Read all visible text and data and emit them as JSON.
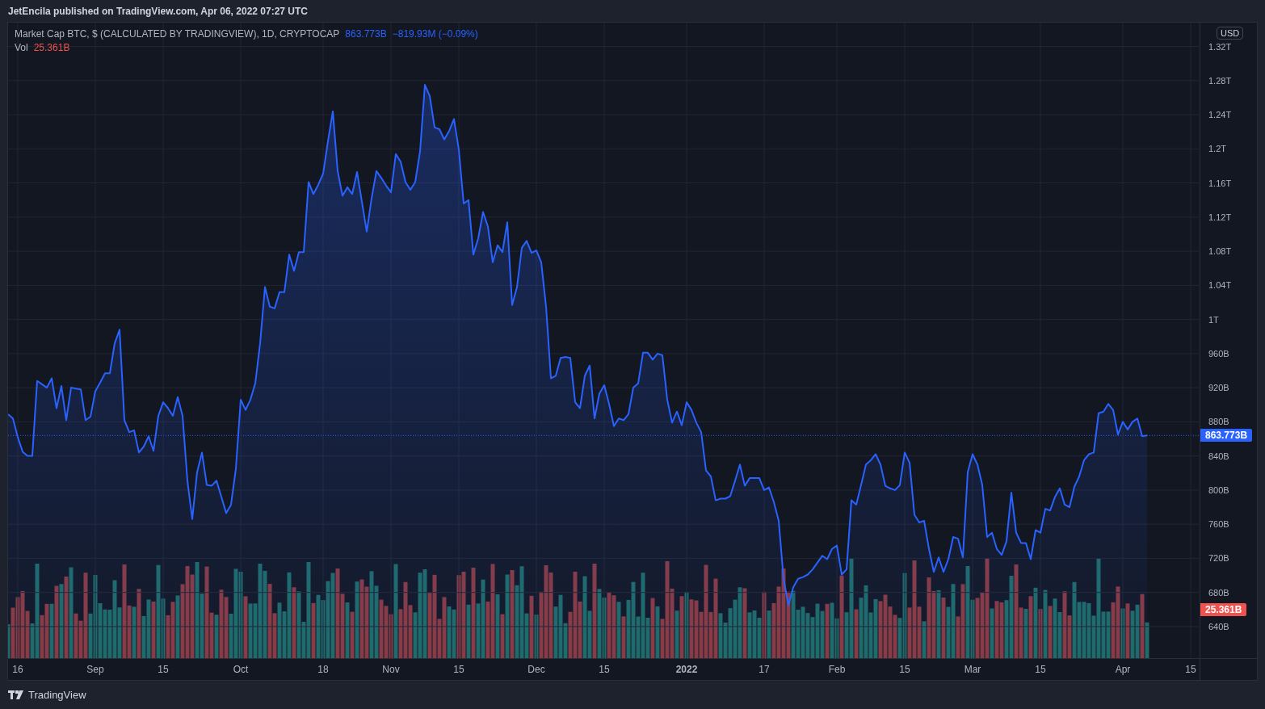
{
  "header": {
    "publisher": "JetEncila published on TradingView.com, Apr 06, 2022 07:27 UTC"
  },
  "legend": {
    "symbol": "Market Cap BTC, $ (CALCULATED BY TRADINGVIEW), 1D, CRYPTOCAP",
    "last": "863.773B",
    "change": "−819.93M (−0.09%)",
    "volume_label": "Vol",
    "volume_value": "25.361B"
  },
  "price_axis": {
    "currency": "USD",
    "last_price_tag": "863.773B",
    "volume_tag": "25.361B"
  },
  "chart": {
    "chart_data": {
      "type": "area",
      "grid": true,
      "ylim": [
        603000000000.0,
        1348000000000.0
      ],
      "categories": [
        null,
        null,
        "16",
        null,
        null,
        null,
        null,
        null,
        null,
        null,
        null,
        null,
        null,
        null,
        null,
        null,
        null,
        null,
        "Sep",
        null,
        null,
        null,
        null,
        null,
        null,
        null,
        null,
        null,
        null,
        null,
        null,
        null,
        "15",
        null,
        null,
        null,
        null,
        null,
        null,
        null,
        null,
        null,
        null,
        null,
        null,
        null,
        null,
        null,
        "Oct",
        null,
        null,
        null,
        null,
        null,
        null,
        null,
        null,
        null,
        null,
        null,
        null,
        null,
        null,
        null,
        null,
        "18",
        null,
        null,
        null,
        null,
        null,
        null,
        null,
        null,
        null,
        null,
        null,
        null,
        null,
        "Nov",
        null,
        null,
        null,
        null,
        null,
        null,
        null,
        null,
        null,
        null,
        null,
        null,
        null,
        "15",
        null,
        null,
        null,
        null,
        null,
        null,
        null,
        null,
        null,
        null,
        null,
        null,
        null,
        null,
        null,
        "Dec",
        null,
        null,
        null,
        null,
        null,
        null,
        null,
        null,
        null,
        null,
        null,
        null,
        null,
        "15",
        null,
        null,
        null,
        null,
        null,
        null,
        null,
        null,
        null,
        null,
        null,
        null,
        null,
        null,
        null,
        null,
        "2022",
        null,
        null,
        null,
        null,
        null,
        null,
        null,
        null,
        null,
        null,
        null,
        null,
        null,
        null,
        null,
        "17",
        null,
        null,
        null,
        null,
        null,
        null,
        null,
        null,
        null,
        null,
        null,
        null,
        null,
        null,
        "Feb",
        null,
        null,
        null,
        null,
        null,
        null,
        null,
        null,
        null,
        null,
        null,
        null,
        null,
        "15",
        null,
        null,
        null,
        null,
        null,
        null,
        null,
        null,
        null,
        null,
        null,
        null,
        null,
        "Mar",
        null,
        null,
        null,
        null,
        null,
        null,
        null,
        null,
        null,
        null,
        null,
        null,
        null,
        "15",
        null,
        null,
        null,
        null,
        null,
        null,
        null,
        null,
        null,
        null,
        null,
        null,
        null,
        null,
        null,
        null,
        "Apr",
        null,
        null,
        null,
        null,
        null,
        null,
        null,
        null,
        null,
        null,
        null,
        null,
        null,
        "15",
        null,
        null
      ],
      "series": [
        {
          "color": "#2962ff",
          "values": [
            889000000000.0,
            884000000000.0,
            862000000000.0,
            845000000000.0,
            840000000000.0,
            840000000000.0,
            928000000000.0,
            924000000000.0,
            920000000000.0,
            931000000000.0,
            896000000000.0,
            922000000000.0,
            882000000000.0,
            920000000000.0,
            919000000000.0,
            918000000000.0,
            882000000000.0,
            886000000000.0,
            916000000000.0,
            926000000000.0,
            937000000000.0,
            937000000000.0,
            972000000000.0,
            988000000000.0,
            882000000000.0,
            868000000000.0,
            870000000000.0,
            844000000000.0,
            851000000000.0,
            863000000000.0,
            846000000000.0,
            887000000000.0,
            903000000000.0,
            896000000000.0,
            887000000000.0,
            909000000000.0,
            887000000000.0,
            811000000000.0,
            766000000000.0,
            821000000000.0,
            844000000000.0,
            806000000000.0,
            805000000000.0,
            811000000000.0,
            792000000000.0,
            773000000000.0,
            783000000000.0,
            825000000000.0,
            906000000000.0,
            894000000000.0,
            906000000000.0,
            925000000000.0,
            972000000000.0,
            1038000000000.0,
            1015000000000.0,
            1013000000000.0,
            1032000000000.0,
            1032000000000.0,
            1076000000000.0,
            1057000000000.0,
            1079000000000.0,
            1079000000000.0,
            1161000000000.0,
            1147000000000.0,
            1158000000000.0,
            1171000000000.0,
            1209000000000.0,
            1244000000000.0,
            1174000000000.0,
            1145000000000.0,
            1155000000000.0,
            1147000000000.0,
            1173000000000.0,
            1138000000000.0,
            1103000000000.0,
            1142000000000.0,
            1174000000000.0,
            1166000000000.0,
            1157000000000.0,
            1149000000000.0,
            1194000000000.0,
            1185000000000.0,
            1161000000000.0,
            1152000000000.0,
            1161000000000.0,
            1197000000000.0,
            1275000000000.0,
            1262000000000.0,
            1225000000000.0,
            1223000000000.0,
            1211000000000.0,
            1221000000000.0,
            1235000000000.0,
            1199000000000.0,
            1136000000000.0,
            1140000000000.0,
            1076000000000.0,
            1095000000000.0,
            1126000000000.0,
            1109000000000.0,
            1067000000000.0,
            1087000000000.0,
            1079000000000.0,
            1114000000000.0,
            1017000000000.0,
            1038000000000.0,
            1084000000000.0,
            1092000000000.0,
            1078000000000.0,
            1081000000000.0,
            1067000000000.0,
            1015000000000.0,
            931000000000.0,
            934000000000.0,
            955000000000.0,
            956000000000.0,
            955000000000.0,
            903000000000.0,
            896000000000.0,
            934000000000.0,
            946000000000.0,
            884000000000.0,
            913000000000.0,
            923000000000.0,
            901000000000.0,
            875000000000.0,
            884000000000.0,
            882000000000.0,
            889000000000.0,
            920000000000.0,
            925000000000.0,
            961000000000.0,
            961000000000.0,
            953000000000.0,
            960000000000.0,
            958000000000.0,
            906000000000.0,
            879000000000.0,
            892000000000.0,
            876000000000.0,
            903000000000.0,
            894000000000.0,
            879000000000.0,
            868000000000.0,
            823000000000.0,
            816000000000.0,
            788000000000.0,
            790000000000.0,
            790000000000.0,
            793000000000.0,
            811000000000.0,
            830000000000.0,
            805000000000.0,
            814000000000.0,
            814000000000.0,
            814000000000.0,
            800000000000.0,
            803000000000.0,
            786000000000.0,
            764000000000.0,
            696000000000.0,
            665000000000.0,
            686000000000.0,
            696000000000.0,
            698000000000.0,
            701000000000.0,
            707000000000.0,
            715000000000.0,
            723000000000.0,
            719000000000.0,
            731000000000.0,
            735000000000.0,
            701000000000.0,
            707000000000.0,
            788000000000.0,
            783000000000.0,
            806000000000.0,
            830000000000.0,
            835000000000.0,
            842000000000.0,
            830000000000.0,
            805000000000.0,
            802000000000.0,
            800000000000.0,
            806000000000.0,
            844000000000.0,
            832000000000.0,
            771000000000.0,
            762000000000.0,
            764000000000.0,
            731000000000.0,
            704000000000.0,
            721000000000.0,
            704000000000.0,
            719000000000.0,
            745000000000.0,
            743000000000.0,
            721000000000.0,
            821000000000.0,
            842000000000.0,
            830000000000.0,
            806000000000.0,
            745000000000.0,
            750000000000.0,
            731000000000.0,
            724000000000.0,
            740000000000.0,
            797000000000.0,
            750000000000.0,
            738000000000.0,
            738000000000.0,
            719000000000.0,
            753000000000.0,
            750000000000.0,
            778000000000.0,
            776000000000.0,
            792000000000.0,
            802000000000.0,
            783000000000.0,
            780000000000.0,
            804000000000.0,
            816000000000.0,
            835000000000.0,
            842000000000.0,
            844000000000.0,
            890000000000.0,
            892000000000.0,
            901000000000.0,
            894000000000.0,
            865000000000.0,
            880000000000.0,
            871000000000.0,
            880000000000.0,
            884000000000.0,
            863000000000.0,
            864000000000.0,
            null,
            null,
            null,
            null,
            null,
            null,
            null,
            null,
            null,
            null,
            null
          ]
        }
      ],
      "yticks": [
        {
          "value": 640000000000.0,
          "label": "640B"
        },
        {
          "value": 680000000000.0,
          "label": "680B"
        },
        {
          "value": 720000000000.0,
          "label": "720B"
        },
        {
          "value": 760000000000.0,
          "label": "760B"
        },
        {
          "value": 800000000000.0,
          "label": "800B"
        },
        {
          "value": 840000000000.0,
          "label": "840B"
        },
        {
          "value": 880000000000.0,
          "label": "880B"
        },
        {
          "value": 920000000000.0,
          "label": "920B"
        },
        {
          "value": 960000000000.0,
          "label": "960B"
        },
        {
          "value": 1000000000000.0,
          "label": "1T"
        },
        {
          "value": 1040000000000.0,
          "label": "1.04T"
        },
        {
          "value": 1080000000000.0,
          "label": "1.08T"
        },
        {
          "value": 1120000000000.0,
          "label": "1.12T"
        },
        {
          "value": 1160000000000.0,
          "label": "1.16T"
        },
        {
          "value": 1200000000000.0,
          "label": "1.2T"
        },
        {
          "value": 1240000000000.0,
          "label": "1.24T"
        },
        {
          "value": 1280000000000.0,
          "label": "1.28T"
        },
        {
          "value": 1320000000000.0,
          "label": "1.32T"
        }
      ]
    }
  },
  "footer": {
    "brand": "TradingView"
  }
}
